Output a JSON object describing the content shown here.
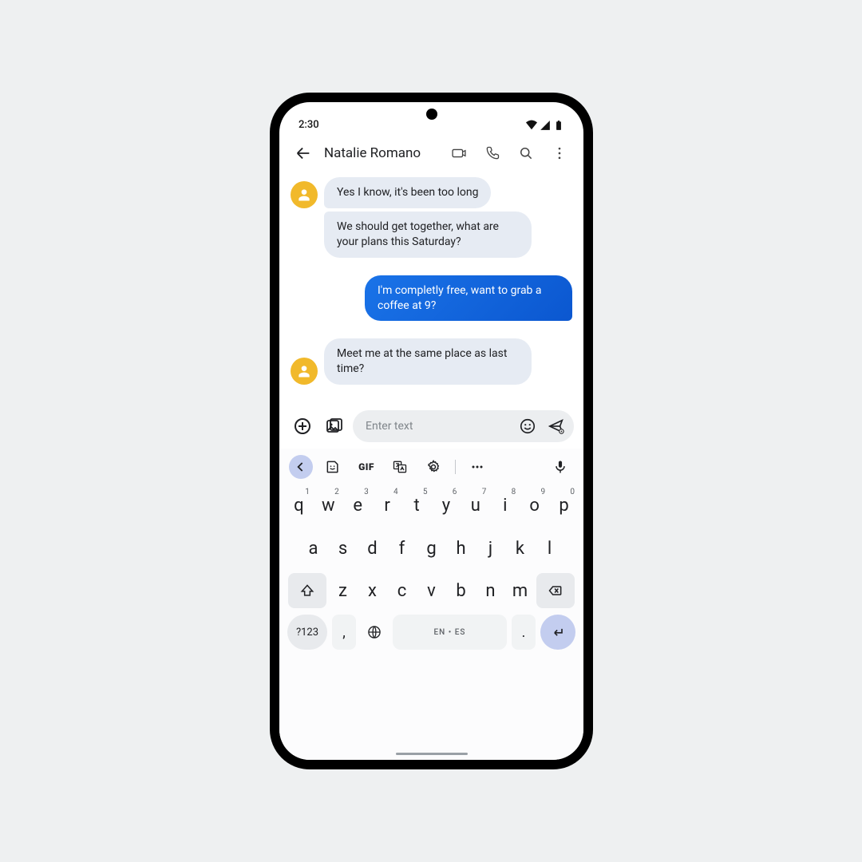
{
  "status": {
    "time": "2:30"
  },
  "header": {
    "contact_name": "Natalie Romano"
  },
  "messages": {
    "m0": "Yes I know, it's been too long",
    "m1": "We should get together, what are your plans this Saturday?",
    "m2": "I'm completly free, want to grab a coffee at 9?",
    "m3": "Meet me at the same place as last time?"
  },
  "composer": {
    "placeholder": "Enter text"
  },
  "keyboard": {
    "gif_label": "GIF",
    "row1": {
      "k0": "q",
      "k1": "w",
      "k2": "e",
      "k3": "r",
      "k4": "t",
      "k5": "y",
      "k6": "u",
      "k7": "i",
      "k8": "o",
      "k9": "p"
    },
    "row1_hints": {
      "h0": "1",
      "h1": "2",
      "h2": "3",
      "h3": "4",
      "h4": "5",
      "h5": "6",
      "h6": "7",
      "h7": "8",
      "h8": "9",
      "h9": "0"
    },
    "row2": {
      "k0": "a",
      "k1": "s",
      "k2": "d",
      "k3": "f",
      "k4": "g",
      "k5": "h",
      "k6": "j",
      "k7": "k",
      "k8": "l"
    },
    "row3": {
      "k0": "z",
      "k1": "x",
      "k2": "c",
      "k3": "v",
      "k4": "b",
      "k5": "n",
      "k6": "m"
    },
    "fn123": "?123",
    "comma": ",",
    "period": ".",
    "space_label": "EN • ES"
  }
}
